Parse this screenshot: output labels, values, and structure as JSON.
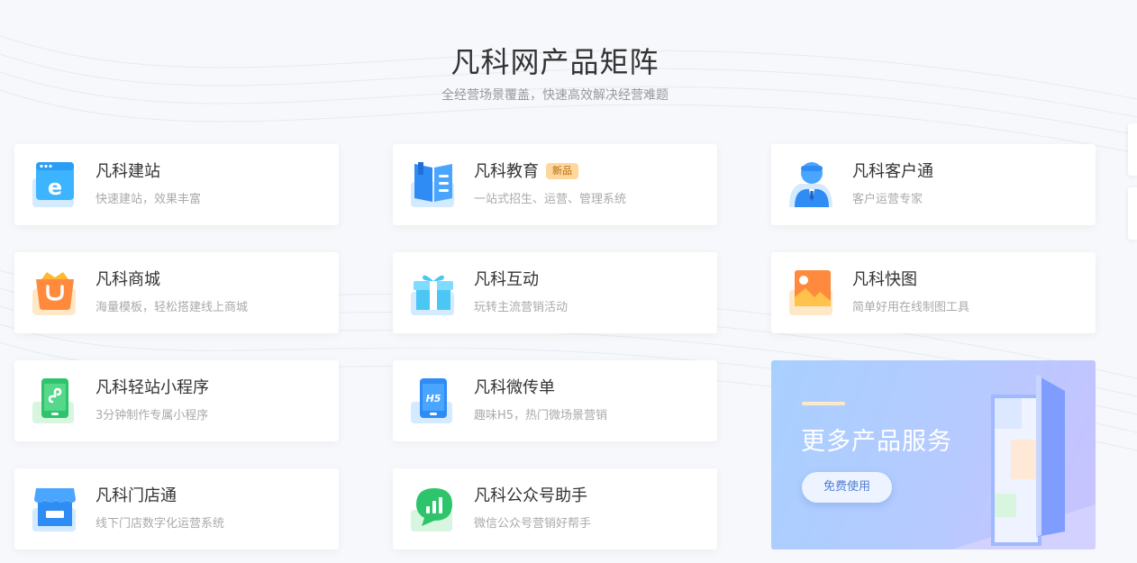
{
  "section": {
    "title": "凡科网产品矩阵",
    "subtitle": "全经营场景覆盖，快速高效解决经营难题"
  },
  "products": [
    {
      "name": "凡科建站",
      "desc": "快速建站，效果丰富",
      "icon": "website-browser-icon"
    },
    {
      "name": "凡科教育",
      "desc": "一站式招生、运营、管理系统",
      "icon": "education-book-icon",
      "badge": "新品"
    },
    {
      "name": "凡科客户通",
      "desc": "客户运营专家",
      "icon": "customer-person-icon"
    },
    {
      "name": "凡科商城",
      "desc": "海量模板，轻松搭建线上商城",
      "icon": "shopping-bag-icon"
    },
    {
      "name": "凡科互动",
      "desc": "玩转主流营销活动",
      "icon": "gift-box-icon"
    },
    {
      "name": "凡科快图",
      "desc": "简单好用在线制图工具",
      "icon": "image-picture-icon"
    },
    {
      "name": "凡科轻站小程序",
      "desc": "3分钟制作专属小程序",
      "icon": "mini-program-phone-icon"
    },
    {
      "name": "凡科微传单",
      "desc": "趣味H5，热门微场景营销",
      "icon": "h5-phone-icon"
    },
    {
      "name": "凡科门店通",
      "desc": "线下门店数字化运营系统",
      "icon": "store-front-icon"
    },
    {
      "name": "凡科公众号助手",
      "desc": "微信公众号营销好帮手",
      "icon": "chat-bubble-chart-icon"
    }
  ],
  "promo": {
    "title": "更多产品服务",
    "button_label": "免费使用"
  },
  "colors": {
    "accent_blue": "#3d8bff",
    "badge_bg": "#ffd79b",
    "promo_gradient_start": "#a8d0ff",
    "promo_gradient_end": "#c9c2ff"
  }
}
